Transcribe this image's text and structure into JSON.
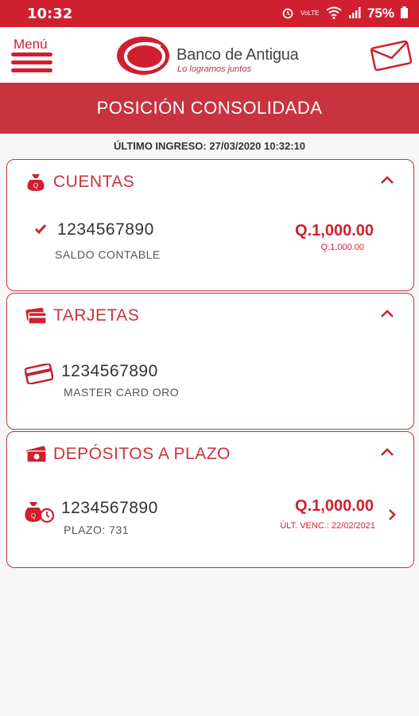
{
  "status_bar": {
    "time": "10:32",
    "network": "VoLTE",
    "battery": "75%"
  },
  "header": {
    "menu_label": "Menú",
    "bank_name": "Banco de Antigua",
    "tagline": "Lo logramos juntos",
    "icons": {
      "menu": "hamburger-icon",
      "mail": "envelope-icon",
      "logo": "bank-logo"
    }
  },
  "page": {
    "title": "POSICIÓN CONSOLIDADA",
    "last_login": "ÚLTIMO INGRESO: 27/03/2020 10:32:10"
  },
  "sections": {
    "cuentas": {
      "title": "CUENTAS",
      "icon": "money-bag-icon",
      "items": [
        {
          "number": "1234567890",
          "label": "SALDO CONTABLE",
          "amount": "Q.1,000.00",
          "sub_amount": "Q.1,000.00"
        }
      ]
    },
    "tarjetas": {
      "title": "TARJETAS",
      "icon": "credit-cards-icon",
      "items": [
        {
          "number": "1234567890",
          "label": "MASTER CARD ORO"
        }
      ]
    },
    "depositos": {
      "title": "DEPÓSITOS A PLAZO",
      "icon": "cash-icon",
      "items": [
        {
          "number": "1234567890",
          "label": "PLAZO: 731",
          "amount": "Q.1,000.00",
          "maturity": "ÚLT. VENC.: 22/02/2021"
        }
      ]
    }
  },
  "colors": {
    "primary": "#d01f2e",
    "title_bar": "#c8333f",
    "background": "#f6f6f6"
  }
}
